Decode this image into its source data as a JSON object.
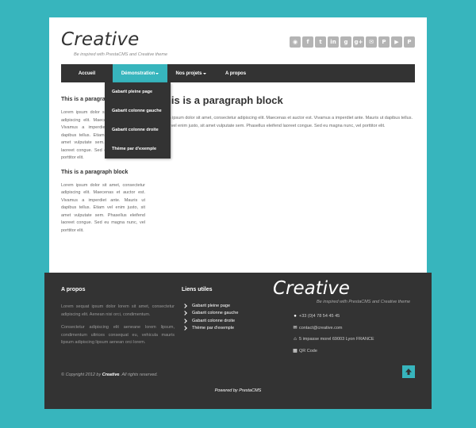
{
  "brand": {
    "title": "Creative",
    "tagline": "Be inspired with PrestaCMS and Creative theme"
  },
  "social": [
    {
      "icon": "rss-icon",
      "glyph": "◉"
    },
    {
      "icon": "facebook-icon",
      "glyph": "f"
    },
    {
      "icon": "twitter-icon",
      "glyph": "t"
    },
    {
      "icon": "linkedin-icon",
      "glyph": "in"
    },
    {
      "icon": "google-icon",
      "glyph": "g"
    },
    {
      "icon": "google-plus-icon",
      "glyph": "g+"
    },
    {
      "icon": "mail-icon",
      "glyph": "✉"
    },
    {
      "icon": "pinterest-icon",
      "glyph": "P"
    },
    {
      "icon": "youtube-icon",
      "glyph": "▶"
    },
    {
      "icon": "paypal-icon",
      "glyph": "P"
    }
  ],
  "nav": {
    "items": [
      "Accueil",
      "Démonstration",
      "Nos projets",
      "A propos"
    ],
    "dropdown": [
      "Gabarit pleine page",
      "Gabarit colonne gauche",
      "Gabarit colonne droite",
      "Thème par d'exemple"
    ]
  },
  "sidebar": {
    "blocks": [
      {
        "title": "This is a paragraph block",
        "text": "Lorem ipsum dolor sit amet, consectetur adipiscing elit. Maecenas et auctor est. Vivamus a imperdiet ante. Mauris ut dapibus tellus. Etiam vel enim justo, sit amet vulputate sem. Phasellus eleifend laoreet congue. Sed eu magna nunc, vel porttitor elit."
      },
      {
        "title": "This is a paragraph block",
        "text": "Lorem ipsum dolor sit amet, consectetur adipiscing elit. Maecenas et auctor est. Vivamus a imperdiet ante. Mauris ut dapibus tellus. Etiam vel enim justo, sit amet vulputate sem. Phasellus eleifend laoreet congue. Sed eu magna nunc, vel porttitor elit."
      }
    ]
  },
  "main": {
    "title": "This is a paragraph block",
    "text": "Lorem ipsum dolor sit amet, consectetur adipiscing elit. Maecenas et auctor est. Vivamus a imperdiet ante. Mauris ut dapibus tellus. Etiam vel enim justo, sit amet vulputate sem. Phasellus eleifend laoreet congue. Sed eu magna nunc, vel porttitor elit."
  },
  "footer": {
    "apropos": {
      "title": "A propos",
      "p1": "Lorem sequat ipsum dolor lorem sit amet, consectetur adipiscing elit. Aenean nisi orci, condimentum.",
      "p2": "Consectetur adipiscing elit aeneane lorem lipsum, condimentum ultrices consequat eu, vehicula mauris lipsum adipiscing lipsum aenean orci lorem."
    },
    "links": {
      "title": "Liens utiles",
      "items": [
        "Gabarit pleine page",
        "Gabarit colonne gauche",
        "Gabarit colonne droite",
        "Thème par d'exemple"
      ]
    },
    "brand": {
      "title": "Creative",
      "tagline": "Be inspired with PrestaCMS and Creative theme"
    },
    "contacts": {
      "phone": "+33 (0)4 78 54 45 45",
      "email": "contact@creative.com",
      "address": "5 impasse morel 69003 Lyon FRANCE",
      "qr": "QR Code"
    },
    "copyright_prefix": "© Copyright 2012 by ",
    "copyright_brand": "Creative",
    "copyright_suffix": ". All rights reserved.",
    "powered": "Powered by PrestaCMS"
  },
  "colors": {
    "accent": "#37b5bd",
    "dark": "#333333",
    "social": "#b4b4b4"
  }
}
